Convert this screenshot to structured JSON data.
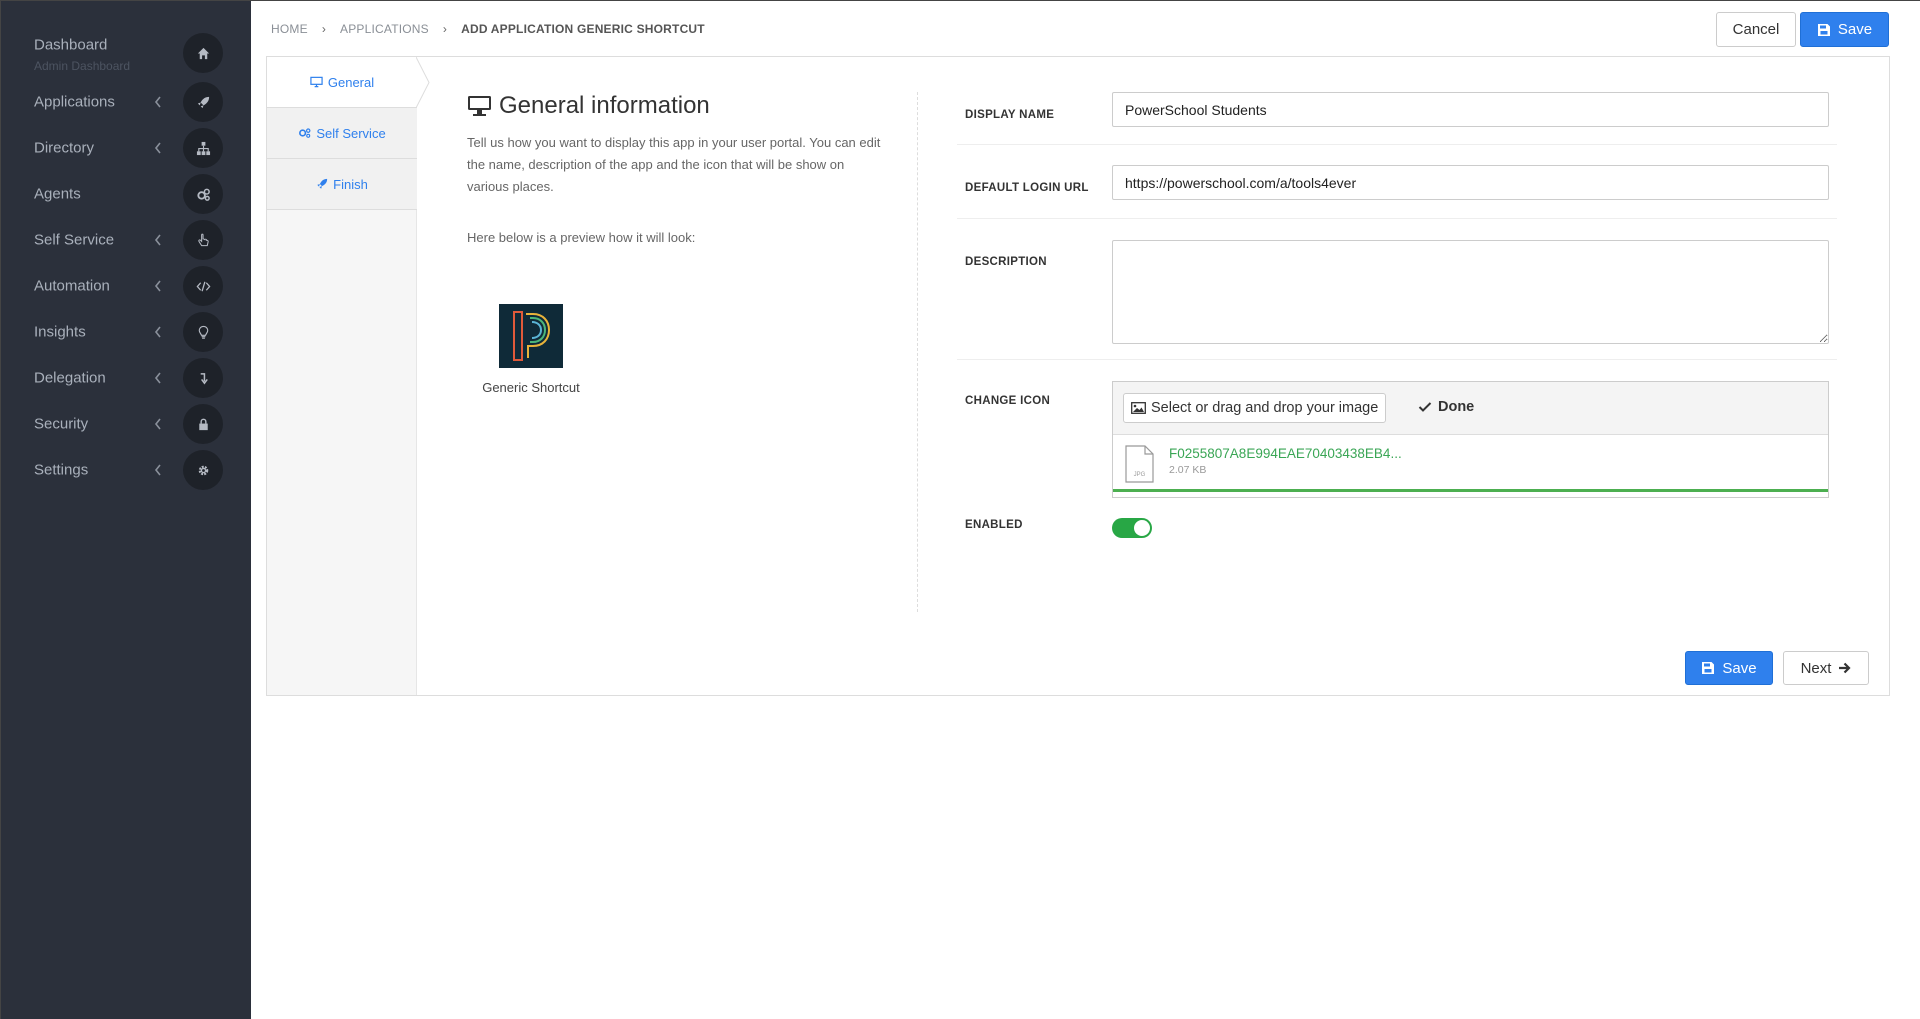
{
  "sidebar": {
    "items": [
      {
        "label": "Dashboard",
        "sublabel": "Admin Dashboard",
        "icon": "home-icon"
      },
      {
        "label": "Applications",
        "icon": "rocket-icon"
      },
      {
        "label": "Directory",
        "icon": "sitemap-icon"
      },
      {
        "label": "Agents",
        "icon": "cogs-icon"
      },
      {
        "label": "Self Service",
        "icon": "hand-pointer-icon"
      },
      {
        "label": "Automation",
        "icon": "code-icon"
      },
      {
        "label": "Insights",
        "icon": "lightbulb-icon"
      },
      {
        "label": "Delegation",
        "icon": "level-down-icon"
      },
      {
        "label": "Security",
        "icon": "lock-icon"
      },
      {
        "label": "Settings",
        "icon": "gear-icon"
      }
    ]
  },
  "breadcrumb": {
    "home": "HOME",
    "applications": "APPLICATIONS",
    "current": "ADD APPLICATION GENERIC SHORTCUT"
  },
  "header": {
    "cancel_label": "Cancel",
    "save_label": "Save"
  },
  "tabs": [
    {
      "label": "General"
    },
    {
      "label": "Self Service"
    },
    {
      "label": "Finish"
    }
  ],
  "general": {
    "title": "General information",
    "description": "Tell us how you want to display this app in your user portal. You can edit the name, description of the app and the icon that will be show on various places.",
    "preview_text": "Here below is a preview how it will look:",
    "preview_caption": "Generic Shortcut"
  },
  "form": {
    "display_name_label": "DISPLAY NAME",
    "display_name_value": "PowerSchool Students",
    "login_url_label": "DEFAULT LOGIN URL",
    "login_url_value": "https://powerschool.com/a/tools4ever",
    "description_label": "DESCRIPTION",
    "description_value": "",
    "change_icon_label": "CHANGE ICON",
    "upload_select_label": "Select or drag and drop your image",
    "upload_done_label": "Done",
    "file_name": "F0255807A8E994EAE70403438EB4...",
    "file_size": "2.07 KB",
    "file_type": "JPG",
    "enabled_label": "ENABLED",
    "enabled": true
  },
  "footer": {
    "save_label": "Save",
    "next_label": "Next"
  },
  "colors": {
    "sidebar_bg": "#2b303b",
    "primary": "#2f80ed",
    "success": "#28a745"
  }
}
